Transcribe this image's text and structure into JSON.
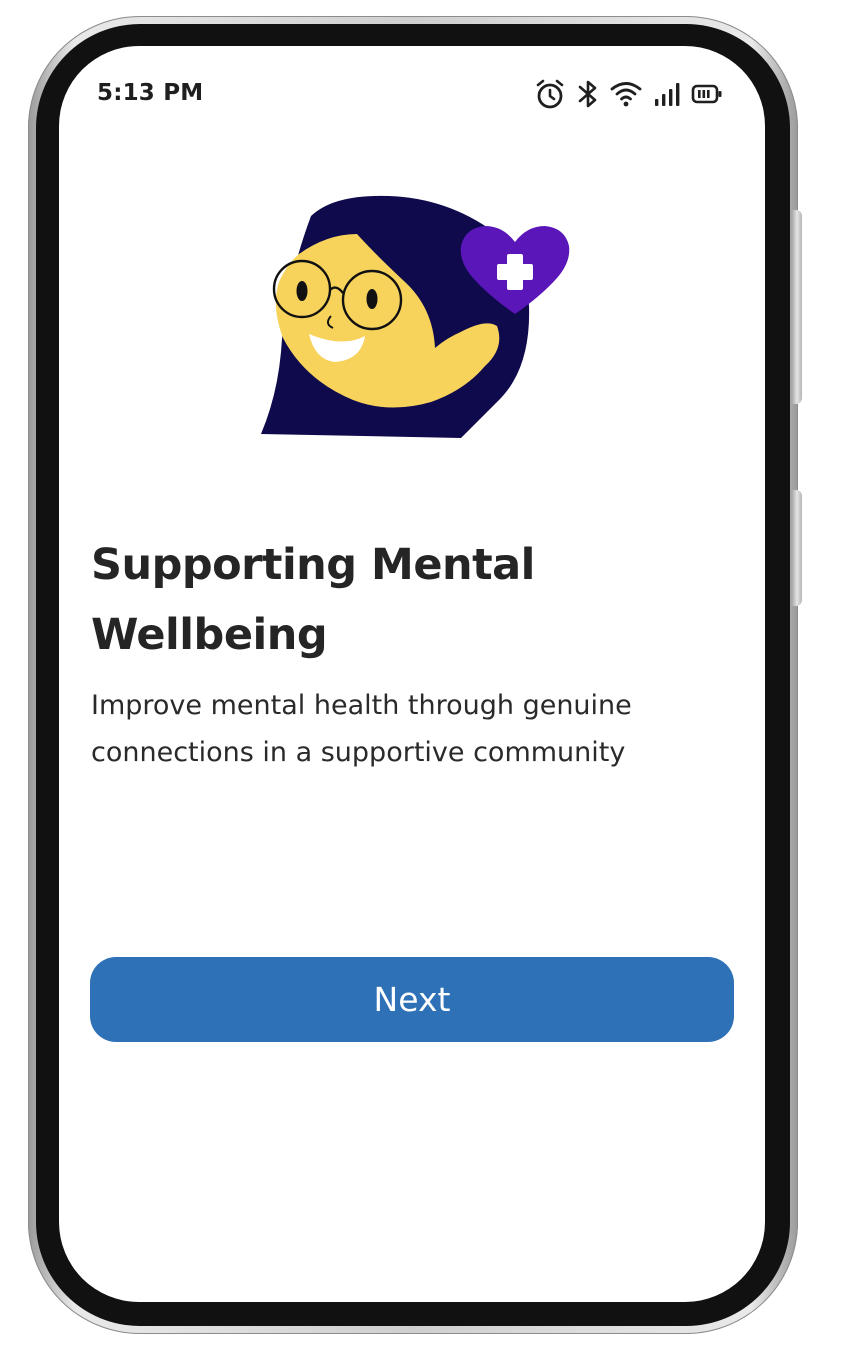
{
  "status_bar": {
    "time": "5:13 PM",
    "icons": [
      "alarm-icon",
      "bluetooth-icon",
      "wifi-icon",
      "signal-icon",
      "battery-icon"
    ]
  },
  "onboarding": {
    "illustration": "person-with-heart-plus-icon",
    "title": "Supporting Mental Wellbeing",
    "subtitle": "Improve mental health through genuine connections in a supportive community",
    "next_label": "Next"
  },
  "colors": {
    "accent": "#2f71b6",
    "heart": "#5a16b8",
    "hair": "#0e0a4c",
    "face": "#f7d35c",
    "text": "#252525"
  }
}
